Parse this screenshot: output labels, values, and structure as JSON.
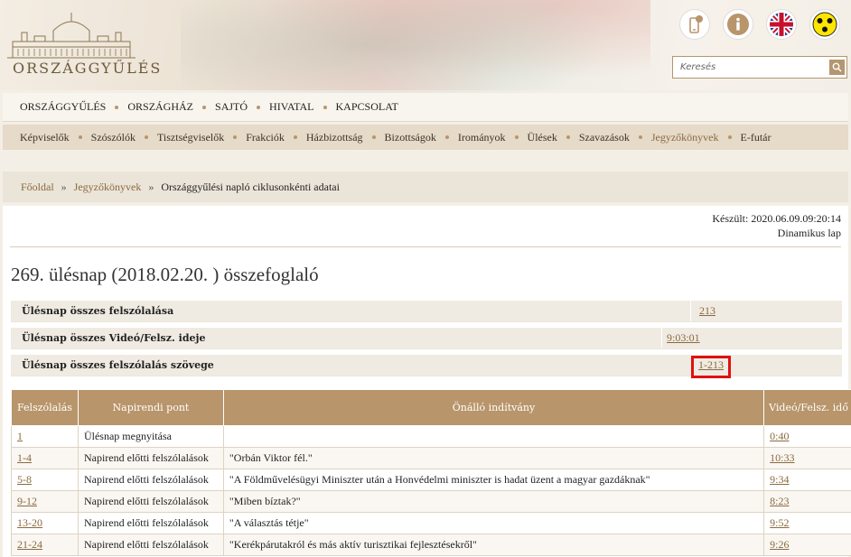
{
  "site": {
    "logo_text": "ORSZÁGGYŰLÉS"
  },
  "top_icons": [
    "phone-icon",
    "info-icon",
    "uk-flag-icon",
    "accessibility-icon"
  ],
  "search": {
    "placeholder": "Keresés"
  },
  "main_nav": [
    "ORSZÁGGYŰLÉS",
    "ORSZÁGHÁZ",
    "SAJTÓ",
    "HIVATAL",
    "KAPCSOLAT"
  ],
  "sub_nav": [
    "Képviselők",
    "Szószólók",
    "Tisztségviselők",
    "Frakciók",
    "Házbizottság",
    "Bizottságok",
    "Irományok",
    "Ülések",
    "Szavazások",
    "Jegyzőkönyvek",
    "E-futár"
  ],
  "sub_nav_active": "Jegyzőkönyvek",
  "breadcrumb": {
    "home": "Főoldal",
    "section": "Jegyzőkönyvek",
    "current": "Országgyűlési napló ciklusonkénti adatai"
  },
  "meta": {
    "created": "Készült: 2020.06.09.09:20:14",
    "dynamic": "Dinamikus lap"
  },
  "page_title": "269. ülésnap (2018.02.20. ) összefoglaló",
  "summary": [
    {
      "label": "Ülésnap összes felszólalása",
      "value": "213"
    },
    {
      "label": "Ülésnap összes Videó/Felsz. ideje",
      "value": "9:03:01"
    },
    {
      "label": "Ülésnap összes felszólalás szövege",
      "value": "1-213"
    }
  ],
  "table": {
    "headers": [
      "Felszólalás",
      "Napirendi pont",
      "Önálló indítvány",
      "Videó/Felsz. idő"
    ],
    "rows": [
      {
        "speech": "1",
        "agenda": "Ülésnap megnyitása",
        "motion": "",
        "time": "0:40"
      },
      {
        "speech": "1-4",
        "agenda": "Napirend előtti felszólalások",
        "motion": "\"Orbán Viktor fél.\"",
        "time": "10:33"
      },
      {
        "speech": "5-8",
        "agenda": "Napirend előtti felszólalások",
        "motion": "\"A Földművelésügyi Miniszter után a Honvédelmi miniszter is hadat üzent a magyar gazdáknak\"",
        "time": "9:34"
      },
      {
        "speech": "9-12",
        "agenda": "Napirend előtti felszólalások",
        "motion": "\"Miben bíztak?\"",
        "time": "8:23"
      },
      {
        "speech": "13-20",
        "agenda": "Napirend előtti felszólalások",
        "motion": "\"A választás tétje\"",
        "time": "9:52"
      },
      {
        "speech": "21-24",
        "agenda": "Napirend előtti felszólalások",
        "motion": "\"Kerékpárutakról és más aktív turisztikai fejlesztésekről\"",
        "time": "9:26"
      }
    ]
  }
}
